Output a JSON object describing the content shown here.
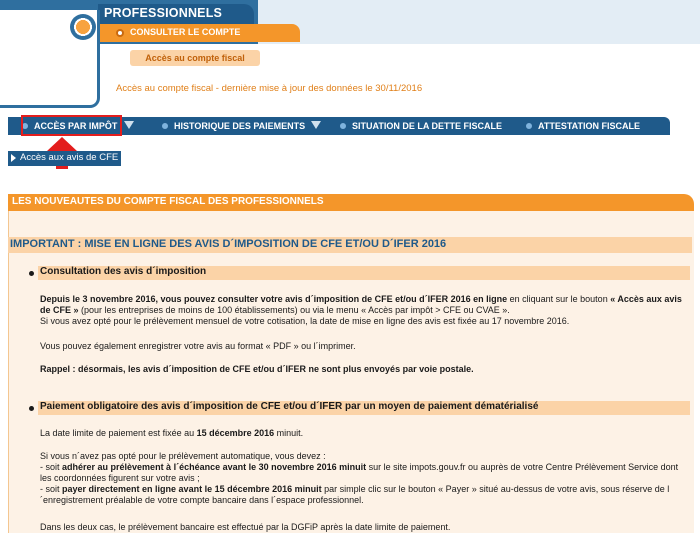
{
  "header": {
    "title": "PROFESSIONNELS",
    "tab_consult": "CONSULTER LE COMPTE",
    "subtab": "Accès au compte fiscal",
    "update_text": "Accès au compte fiscal - dernière mise à jour des données le 30/11/2016"
  },
  "nav": {
    "items": [
      {
        "label": "ACCÈS PAR IMPÔT"
      },
      {
        "label": "HISTORIQUE DES PAIEMENTS"
      },
      {
        "label": "SITUATION DE LA DETTE FISCALE"
      },
      {
        "label": "ATTESTATION FISCALE"
      }
    ]
  },
  "cfe_button": {
    "label": "Accès aux avis de CFE"
  },
  "main": {
    "header": "LES NOUVEAUTES DU COMPTE FISCAL DES PROFESSIONNELS",
    "important": "IMPORTANT : MISE EN LIGNE DES AVIS D´IMPOSITION DE CFE ET/OU D´IFER 2016",
    "section1": {
      "title": "Consultation des avis d´imposition",
      "p1_bold": "Depuis le 3 novembre 2016, vous pouvez consulter votre avis d´imposition de CFE et/ou d´IFER 2016 en ligne",
      "p1_mid": " en cliquant sur le bouton ",
      "p1_bold2": "« Accès aux avis de CFE »",
      "p1_end": " (pour les entreprises de moins de 100 établissements) ou via le menu « Accès par impôt > CFE ou CVAE ».",
      "p1_line3": "Si vous avez opté pour le prélèvement mensuel de votre cotisation, la date de mise en ligne des avis est fixée au 17 novembre 2016.",
      "p2": "Vous pouvez également enregistrer votre avis au format « PDF » ou l´imprimer.",
      "p3_bold": "Rappel : désormais, les avis d´imposition de CFE et/ou d´IFER ne sont plus envoyés par voie postale."
    },
    "section2": {
      "title": "Paiement obligatoire des avis d´imposition de CFE et/ou d´IFER par un moyen de paiement dématérialisé",
      "p1_start": "La date limite de paiement est fixée au ",
      "p1_bold": "15 décembre 2016",
      "p1_end": " minuit.",
      "p2_line1": "Si vous n´avez pas opté pour le prélèvement automatique, vous devez :",
      "p2_dash1": "- soit ",
      "p2_bold1": "adhérer au prélèvement à l´échéance avant le 30 novembre 2016 minuit",
      "p2_rest1": " sur le site impots.gouv.fr ou auprès de votre Centre Prélèvement Service dont les coordonnées figurent sur votre avis ;",
      "p2_dash2": "- soit ",
      "p2_bold2": "payer directement en ligne avant le 15 décembre 2016 minuit",
      "p2_rest2": " par simple clic sur le bouton « Payer » situé au-dessus de votre avis, sous réserve de l´enregistrement préalable de votre compte bancaire dans l´espace professionnel.",
      "p3": "Dans les deux cas, le prélèvement bancaire est effectué par la DGFiP après la date limite de paiement."
    }
  },
  "colors": {
    "brand_blue": "#1f5a8a",
    "accent_orange": "#f4962a",
    "highlight_red": "#e31d1d"
  }
}
